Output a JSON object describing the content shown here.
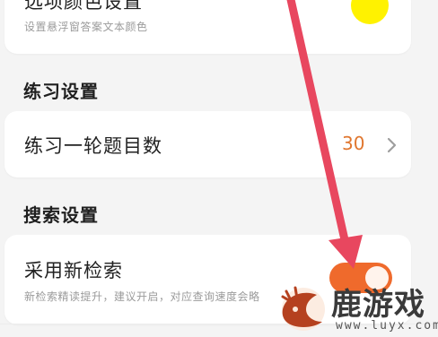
{
  "option_color": {
    "title": "选项颜色设置",
    "subtitle": "设置悬浮窗答案文本颜色",
    "swatch_color": "#fff200"
  },
  "practice_section": {
    "heading": "练习设置",
    "rounds_label": "练习一轮题目数",
    "rounds_value": "30",
    "chevron_icon": "chevron-right-icon"
  },
  "search_section": {
    "heading": "搜索设置",
    "new_search_label": "采用新检索",
    "new_search_desc": "新检索精读提升，建议开启，对应查询速度会略",
    "toggle_on": true,
    "toggle_color": "#ef6a2c"
  },
  "annotation": {
    "arrow_color": "#e8475f"
  },
  "watermark": {
    "brand": "鹿游戏",
    "url": "www.luyx.com"
  }
}
